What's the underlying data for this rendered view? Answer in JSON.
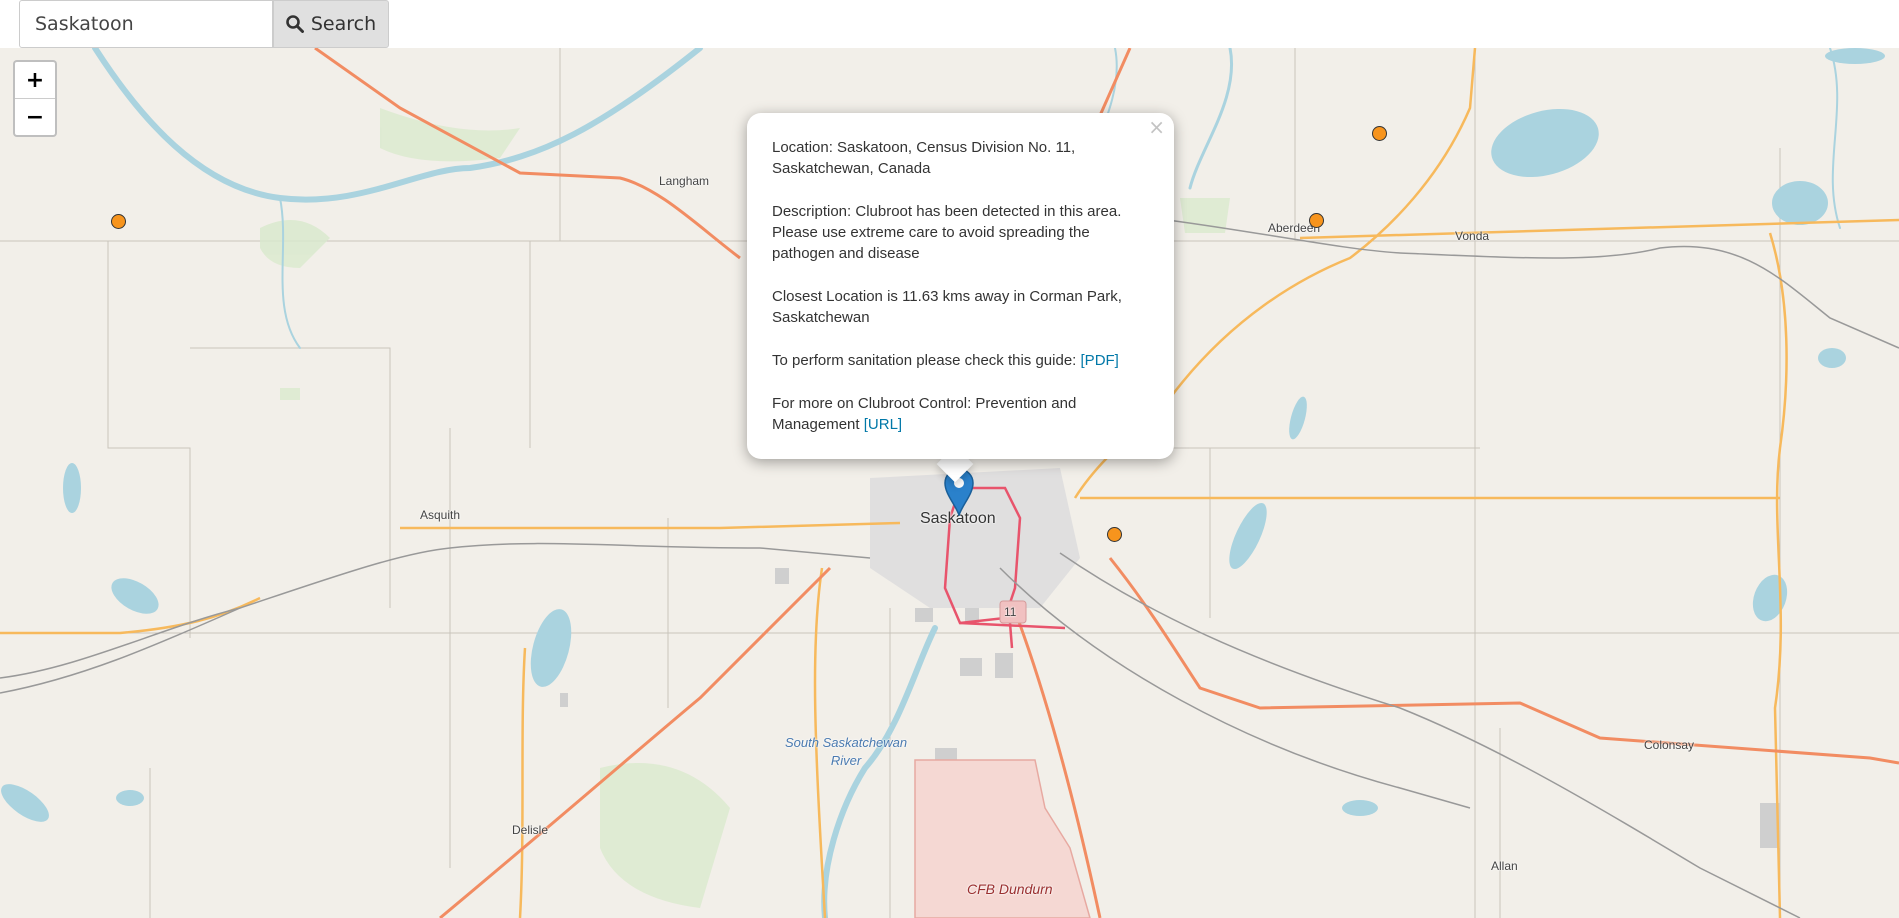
{
  "search": {
    "value": "Saskatoon",
    "button_label": "Search",
    "icon": "search-icon"
  },
  "map": {
    "zoom_in": "+",
    "zoom_out": "−",
    "labels": {
      "langham": "Langham",
      "aberdeen": "Aberdeen",
      "vonda": "Vonda",
      "asquith": "Asquith",
      "saskatoon": "Saskatoon",
      "river_line1": "South Saskatchewan",
      "river_line2": "River",
      "delisle": "Delisle",
      "colonsay": "Colonsay",
      "allan": "Allan",
      "cfb": "CFB Dundurn",
      "highway": "11"
    },
    "colors": {
      "land": "#f2efe9",
      "water": "#aad3df",
      "motorway": "#e8546c",
      "primary": "#f28c62",
      "secondary": "#f7b95c",
      "marker": "#f7941d",
      "pin": "#2a81cb"
    }
  },
  "popup": {
    "close": "×",
    "location": "Location: Saskatoon, Census Division No. 11, Saskatchewan, Canada",
    "description": "Description: Clubroot has been detected in this area. Please use extreme care to avoid spreading the pathogen and disease",
    "closest": "Closest Location is 11.63 kms away in Corman Park, Saskatchewan",
    "sanitation_text": "To perform sanitation please check this guide: ",
    "sanitation_link": "[PDF]",
    "more_text": "For more on Clubroot Control: Prevention and Management ",
    "more_link": "[URL]"
  }
}
